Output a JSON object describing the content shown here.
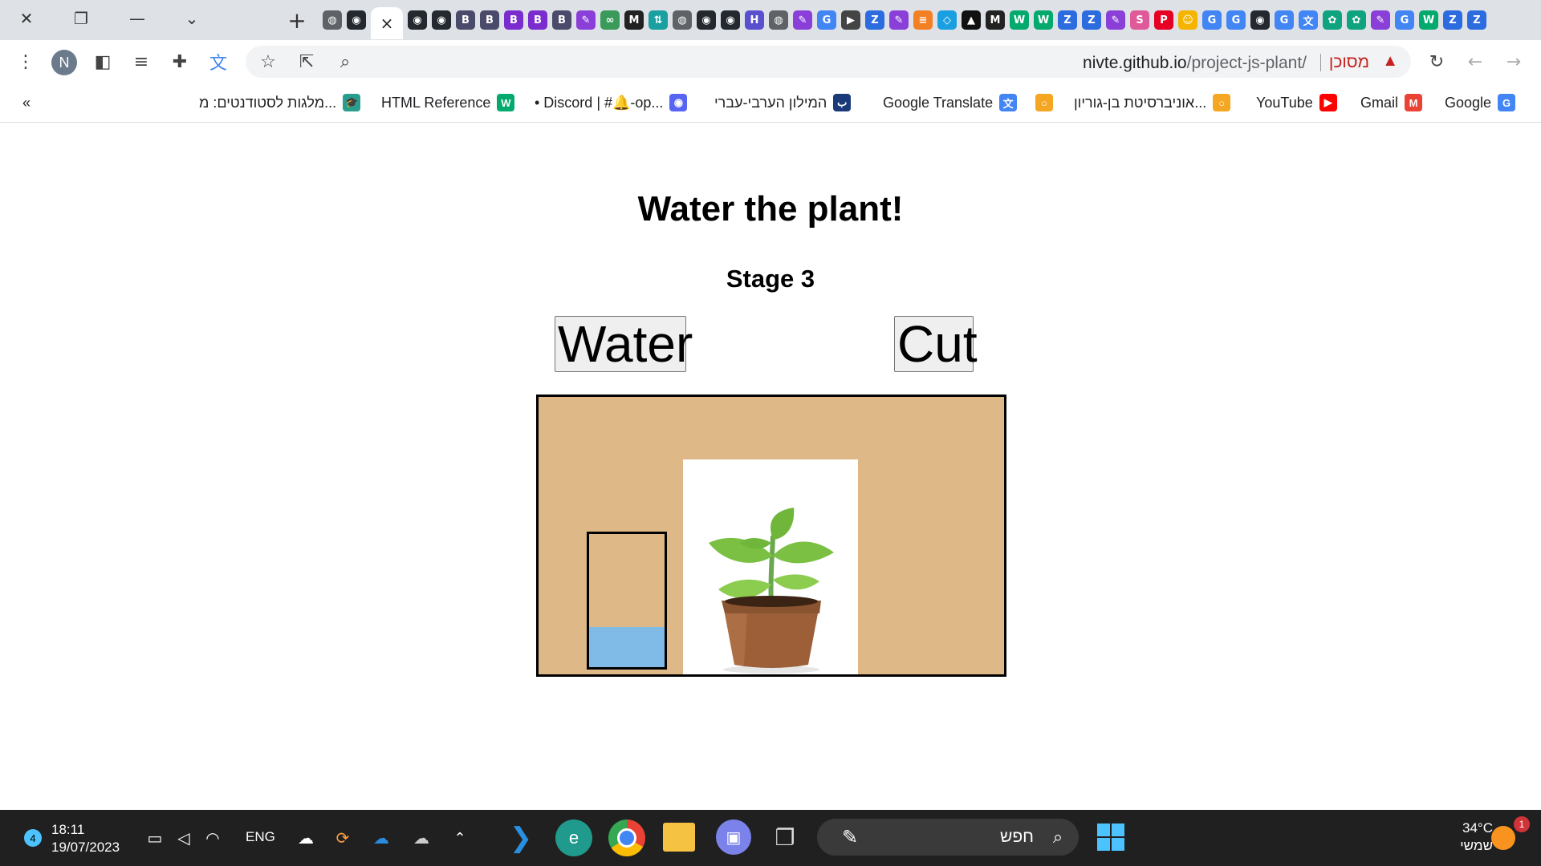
{
  "browser": {
    "url_host": "nivte.github.io",
    "url_path": "/project-js-plant/",
    "security_label": "מסוכן",
    "avatar_letter": "N",
    "active_tab_close": "×",
    "tab_icons": [
      {
        "icon": "globe-icon",
        "color": "#5f6368",
        "glyph": "◍"
      },
      {
        "icon": "github-icon",
        "color": "#24292f",
        "glyph": "◉"
      },
      {
        "icon": "github-icon",
        "color": "#24292f",
        "glyph": "◉"
      },
      {
        "icon": "github-icon",
        "color": "#24292f",
        "glyph": "◉"
      },
      {
        "icon": "b-icon",
        "color": "#4a4a6a",
        "glyph": "B"
      },
      {
        "icon": "b-icon",
        "color": "#4a4a6a",
        "glyph": "B"
      },
      {
        "icon": "b-icon",
        "color": "#7a2ccf",
        "glyph": "B"
      },
      {
        "icon": "b-icon",
        "color": "#7a2ccf",
        "glyph": "B"
      },
      {
        "icon": "b-icon",
        "color": "#4a4a6a",
        "glyph": "B"
      },
      {
        "icon": "chat-icon",
        "color": "#8b3fd9",
        "glyph": "✎"
      },
      {
        "icon": "infinity-icon",
        "color": "#3a9a5a",
        "glyph": "∞"
      },
      {
        "icon": "m-icon",
        "color": "#222222",
        "glyph": "M"
      },
      {
        "icon": "arrows-icon",
        "color": "#1aa0a0",
        "glyph": "⇅"
      },
      {
        "icon": "globe-icon",
        "color": "#5f6368",
        "glyph": "◍"
      },
      {
        "icon": "github-icon",
        "color": "#24292f",
        "glyph": "◉"
      },
      {
        "icon": "github-icon",
        "color": "#24292f",
        "glyph": "◉"
      },
      {
        "icon": "h-icon",
        "color": "#5a4fcf",
        "glyph": "H"
      },
      {
        "icon": "globe-icon",
        "color": "#5f6368",
        "glyph": "◍"
      },
      {
        "icon": "chat-icon",
        "color": "#8b3fd9",
        "glyph": "✎"
      },
      {
        "icon": "google-icon",
        "color": "#4285f4",
        "glyph": "G"
      },
      {
        "icon": "play-icon",
        "color": "#444444",
        "glyph": "▶"
      },
      {
        "icon": "z-icon",
        "color": "#2d6cdf",
        "glyph": "Z"
      },
      {
        "icon": "chat-icon",
        "color": "#8b3fd9",
        "glyph": "✎"
      },
      {
        "icon": "stack-icon",
        "color": "#f48024",
        "glyph": "≡"
      },
      {
        "icon": "diamond-icon",
        "color": "#1aa0e0",
        "glyph": "◇"
      },
      {
        "icon": "ta-icon",
        "color": "#111111",
        "glyph": "▲"
      },
      {
        "icon": "m-icon",
        "color": "#222222",
        "glyph": "M"
      },
      {
        "icon": "w3-icon",
        "color": "#04aa6d",
        "glyph": "W"
      },
      {
        "icon": "w3-icon",
        "color": "#04aa6d",
        "glyph": "W"
      },
      {
        "icon": "z-icon",
        "color": "#2d6cdf",
        "glyph": "Z"
      },
      {
        "icon": "z-icon",
        "color": "#2d6cdf",
        "glyph": "Z"
      },
      {
        "icon": "chat-icon",
        "color": "#8b3fd9",
        "glyph": "✎"
      },
      {
        "icon": "s-icon",
        "color": "#e05a9a",
        "glyph": "S"
      },
      {
        "icon": "pinterest-icon",
        "color": "#e60023",
        "glyph": "P"
      },
      {
        "icon": "face-icon",
        "color": "#f5b400",
        "glyph": "☺"
      },
      {
        "icon": "google-icon",
        "color": "#4285f4",
        "glyph": "G"
      },
      {
        "icon": "google-icon",
        "color": "#4285f4",
        "glyph": "G"
      },
      {
        "icon": "github-icon",
        "color": "#24292f",
        "glyph": "◉"
      },
      {
        "icon": "google-icon",
        "color": "#4285f4",
        "glyph": "G"
      },
      {
        "icon": "translate-icon",
        "color": "#4285f4",
        "glyph": "文"
      },
      {
        "icon": "openai-icon",
        "color": "#10a37f",
        "glyph": "✿"
      },
      {
        "icon": "openai-icon",
        "color": "#10a37f",
        "glyph": "✿"
      },
      {
        "icon": "chat-icon",
        "color": "#8b3fd9",
        "glyph": "✎"
      },
      {
        "icon": "google-icon",
        "color": "#4285f4",
        "glyph": "G"
      },
      {
        "icon": "w3-icon",
        "color": "#04aa6d",
        "glyph": "W"
      },
      {
        "icon": "z-icon",
        "color": "#2d6cdf",
        "glyph": "Z"
      },
      {
        "icon": "z-icon",
        "color": "#2d6cdf",
        "glyph": "Z"
      }
    ]
  },
  "bookmarks": {
    "overflow": "«",
    "items": [
      {
        "label": "מלגות לסטודנטים: מ...",
        "icon": "graduation-cap-icon",
        "color": "#2a9d8f",
        "glyph": "🎓"
      },
      {
        "label": "HTML Reference",
        "icon": "w3schools-icon",
        "color": "#04aa6d",
        "glyph": "W"
      },
      {
        "label": "• Discord | #🔔-op...",
        "icon": "discord-icon",
        "color": "#5865f2",
        "glyph": "◉"
      },
      {
        "label": "המילון הערבי-עברי",
        "icon": "dictionary-icon",
        "color": "#1a3a7a",
        "glyph": "ب"
      },
      {
        "label": "Google Translate",
        "icon": "google-translate-icon",
        "color": "#4285f4",
        "glyph": "文"
      },
      {
        "label": "",
        "icon": "bgu-icon",
        "color": "#f5a623",
        "glyph": "○"
      },
      {
        "label": "אוניברסיטת בן-גוריון...",
        "icon": "bgu-icon",
        "color": "#f5a623",
        "glyph": "○"
      },
      {
        "label": "YouTube",
        "icon": "youtube-icon",
        "color": "#ff0000",
        "glyph": "▶"
      },
      {
        "label": "Gmail",
        "icon": "gmail-icon",
        "color": "#ea4335",
        "glyph": "M"
      },
      {
        "label": "Google",
        "icon": "google-icon",
        "color": "#4285f4",
        "glyph": "G"
      }
    ]
  },
  "page": {
    "title": "Water the plant!",
    "stage": "Stage 3",
    "water_button": "Water",
    "cut_button": "Cut",
    "water_level_fraction": 0.3,
    "colors": {
      "scene_bg": "#deb887",
      "water": "#80bbe8",
      "pot": "#9c5f38",
      "leaves": "#7bc043"
    }
  },
  "taskbar": {
    "notification_count": "4",
    "time": "18:11",
    "date": "19/07/2023",
    "language": "ENG",
    "search_placeholder": "חפש",
    "temperature": "34°C",
    "weather_label": "שמשי",
    "weather_badge": "1"
  }
}
